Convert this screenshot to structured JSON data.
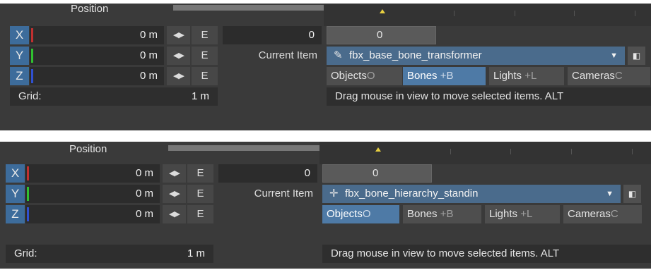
{
  "panels": [
    {
      "position_label": "Position",
      "axes": [
        {
          "label": "X",
          "value": "0 m",
          "bar_color": "#c03030"
        },
        {
          "label": "Y",
          "value": "0 m",
          "bar_color": "#30c030"
        },
        {
          "label": "Z",
          "value": "0 m",
          "bar_color": "#3050d0"
        }
      ],
      "arrows_label": "◀▶",
      "envelope_label": "E",
      "frame_value": "0",
      "slider_value": "0",
      "current_item_label": "Current Item",
      "current_item_icon": "✎",
      "current_item_value": "fbx_base_bone_transformer",
      "dropdown_arrow": "▼",
      "side_button_icon": "◧",
      "modes": [
        {
          "label": "Objects",
          "shortcut": "O",
          "active": false
        },
        {
          "label": "Bones",
          "shortcut": "+B",
          "active": true
        },
        {
          "label": "Lights",
          "shortcut": "+L",
          "active": false
        },
        {
          "label": "Cameras",
          "shortcut": "C",
          "active": false
        }
      ],
      "grid_label": "Grid:",
      "grid_value": "1 m",
      "status": "Drag mouse in view to move selected items. ALT"
    },
    {
      "position_label": "Position",
      "axes": [
        {
          "label": "X",
          "value": "0 m",
          "bar_color": "#c03030"
        },
        {
          "label": "Y",
          "value": "0 m",
          "bar_color": "#30c030"
        },
        {
          "label": "Z",
          "value": "0 m",
          "bar_color": "#3050d0"
        }
      ],
      "arrows_label": "◀▶",
      "envelope_label": "E",
      "frame_value": "0",
      "slider_value": "0",
      "current_item_label": "Current Item",
      "current_item_icon": "✛",
      "current_item_value": "fbx_bone_hierarchy_standin",
      "dropdown_arrow": "▼",
      "side_button_icon": "◧",
      "modes": [
        {
          "label": "Objects",
          "shortcut": "O",
          "active": true
        },
        {
          "label": "Bones",
          "shortcut": "+B",
          "active": false
        },
        {
          "label": "Lights",
          "shortcut": "+L",
          "active": false
        },
        {
          "label": "Cameras",
          "shortcut": "C",
          "active": false
        }
      ],
      "grid_label": "Grid:",
      "grid_value": "1 m",
      "status": "Drag mouse in view to move selected items. ALT"
    }
  ]
}
